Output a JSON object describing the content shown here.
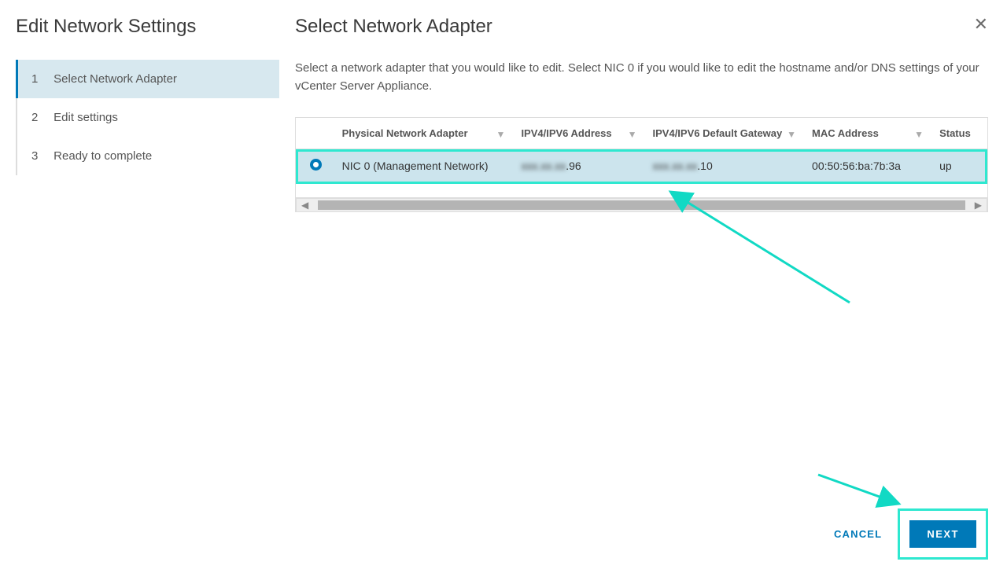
{
  "sidebar": {
    "title": "Edit Network Settings",
    "steps": [
      {
        "num": "1",
        "label": "Select Network Adapter",
        "active": true
      },
      {
        "num": "2",
        "label": "Edit settings",
        "active": false
      },
      {
        "num": "3",
        "label": "Ready to complete",
        "active": false
      }
    ]
  },
  "main": {
    "title": "Select Network Adapter",
    "description": "Select a network adapter that you would like to edit. Select NIC 0 if you would like to edit the hostname and/or DNS settings of your vCenter Server Appliance.",
    "table": {
      "headers": {
        "adapter": "Physical Network Adapter",
        "address": "IPV4/IPV6 Address",
        "gateway": "IPV4/IPV6 Default Gateway",
        "mac": "MAC Address",
        "status": "Status"
      },
      "row": {
        "adapter": "NIC 0 (Management Network)",
        "address_blur": "xxx.xx.xx",
        "address_suffix": ".96",
        "gateway_blur": "xxx.xx.xx",
        "gateway_suffix": ".10",
        "mac": "00:50:56:ba:7b:3a",
        "status": "up"
      }
    }
  },
  "footer": {
    "cancel": "CANCEL",
    "next": "NEXT"
  }
}
